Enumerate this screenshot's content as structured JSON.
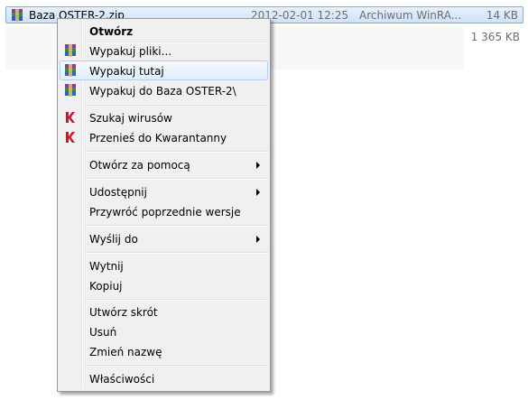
{
  "file": {
    "name": "Baza OSTER-2.zip",
    "date": "2012-02-01 12:25",
    "type": "Archiwum WinRA...",
    "size": "14 KB",
    "icon": "winrar-archive-icon"
  },
  "summary": {
    "total_size": "1 365 KB"
  },
  "menu": {
    "items": {
      "open": "Otwórz",
      "extract_files": "Wypakuj pliki...",
      "extract_here": "Wypakuj tutaj",
      "extract_to": "Wypakuj do Baza OSTER-2\\",
      "scan_virus": "Szukaj wirusów",
      "move_quarantine": "Przenieś do Kwarantanny",
      "open_with": "Otwórz za pomocą",
      "share": "Udostępnij",
      "restore_versions": "Przywróć poprzednie wersje",
      "send_to": "Wyślij do",
      "cut": "Wytnij",
      "copy": "Kopiuj",
      "create_shortcut": "Utwórz skrót",
      "delete": "Usuń",
      "rename": "Zmień nazwę",
      "properties": "Właściwości"
    },
    "highlighted": "extract_here",
    "colors": {
      "hover_border": "#aecff7",
      "hover_bg": "#e3eefb"
    }
  }
}
